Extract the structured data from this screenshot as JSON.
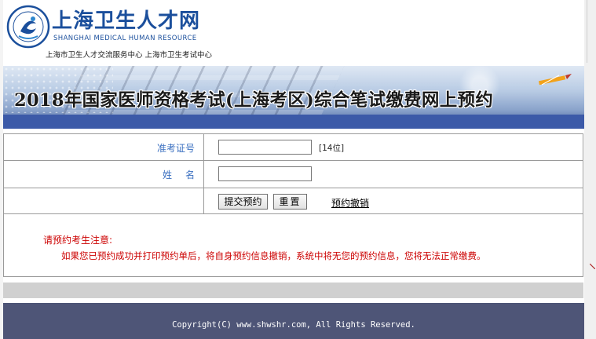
{
  "header": {
    "logo_cn": "上海卫生人才网",
    "logo_en": "SHANGHAI MEDICAL HUMAN RESOURCE",
    "logo_sub": "上海市卫生人才交流服务中心  上海市卫生考试中心"
  },
  "banner": {
    "title": "2018年国家医师资格考试(上海考区)综合笔试缴费网上预约"
  },
  "form": {
    "exam_id_label": "准考证号",
    "exam_id_value": "",
    "exam_id_hint": "[14位]",
    "name_label": "姓名",
    "name_value": "",
    "submit_label": "提交预约",
    "reset_label": "重置",
    "cancel_label": "预约撤销"
  },
  "notice": {
    "title": "请预约考生注意:",
    "text": "如果您已预约成功并打印预约单后，将自身预约信息撤销，系统中将无您的预约信息，您将无法正常缴费。"
  },
  "footer": {
    "copyright": "Copyright(C) www.shwshr.com, All Rights Reserved."
  },
  "colors": {
    "brand_blue": "#1b4f9c",
    "label_blue": "#3a6fc0",
    "notice_red": "#cc0000",
    "footer_bg": "#4e5577"
  }
}
